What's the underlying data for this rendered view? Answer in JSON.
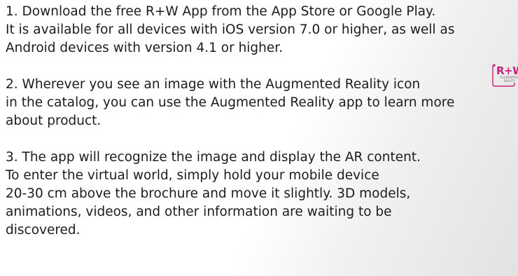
{
  "steps": [
    {
      "lines": [
        "1. Download the free R+W App from the App Store or Google Play.",
        "It is available for all devices with iOS version 7.0 or higher, as well as",
        "Android devices with version 4.1 or higher."
      ]
    },
    {
      "lines": [
        "2. Wherever you see an image with the Augmented Reality icon",
        "in the catalog, you can use the Augmented Reality app to learn more",
        "about product."
      ]
    },
    {
      "lines": [
        "3. The app will recognize the image and display the AR content.",
        "To enter the virtual world, simply hold your mobile device",
        "20-30 cm above the brochure and move it slightly. 3D models,",
        "animations, videos, and other information are waiting to be",
        "discovered."
      ]
    }
  ],
  "ar_icon": {
    "icon": "augmented-reality-icon",
    "letters": "R+W",
    "sub_lines": [
      "AUGMENTED",
      "REALITY"
    ],
    "accent_color": "#c8207a"
  }
}
